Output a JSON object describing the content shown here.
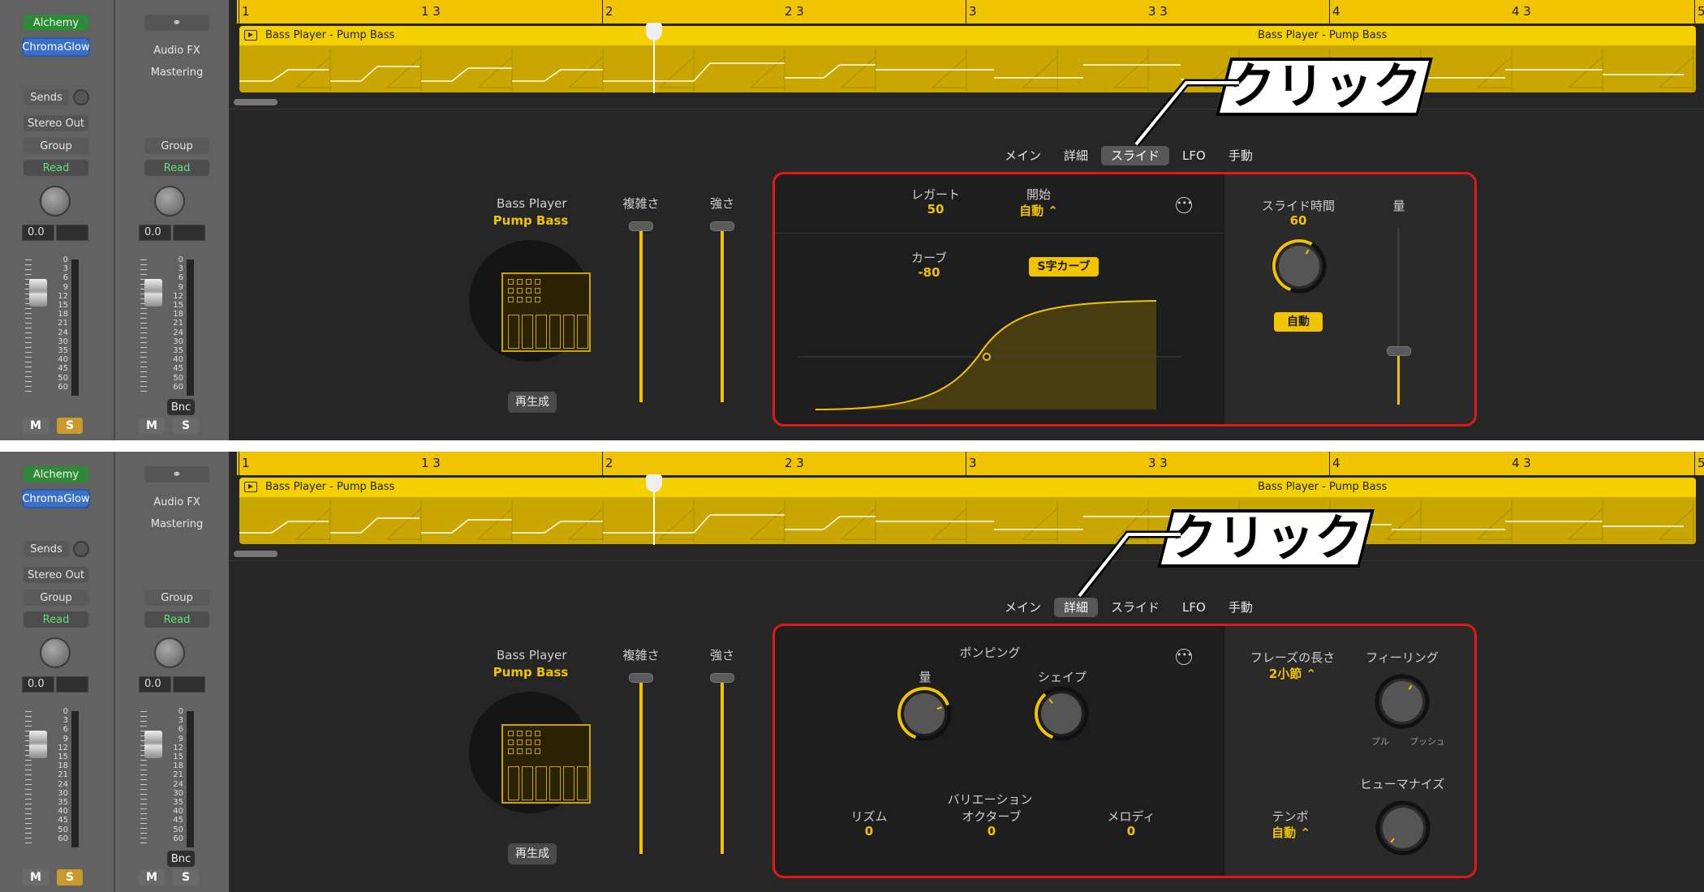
{
  "panels": [
    {
      "mixer": {
        "left": {
          "plugin1": "Alchemy",
          "plugin2": "ChromaGlow",
          "sends": "Sends",
          "output": "Stereo Out",
          "group": "Group",
          "automation": "Read",
          "volume": "0.0",
          "mute": "M",
          "solo": "S"
        },
        "right": {
          "slot_icon": "link-icon",
          "audio_fx": "Audio FX",
          "mastering": "Mastering",
          "group": "Group",
          "automation": "Read",
          "volume": "0.0",
          "bounce": "Bnc",
          "mute": "M",
          "solo": "S"
        },
        "scale": [
          "0",
          "3",
          "6",
          "9",
          "12",
          "15",
          "18",
          "21",
          "24",
          "30",
          "35",
          "40",
          "45",
          "50",
          "60"
        ]
      },
      "ruler": {
        "bars": [
          "1",
          "2",
          "3",
          "4",
          "5"
        ],
        "beats": [
          "1 3",
          "2 3",
          "3 3",
          "4 3"
        ]
      },
      "region": {
        "name": "Bass Player - Pump Bass",
        "name2": "Bass Player - Pump Bass"
      },
      "tabs": [
        "メイン",
        "詳細",
        "スライド",
        "LFO",
        "手動"
      ],
      "active_tab": 2,
      "player": {
        "title": "Bass Player",
        "preset": "Pump Bass",
        "complexity": "複雑さ",
        "intensity": "強さ",
        "regenerate": "再生成"
      },
      "slide": {
        "legato_label": "レガート",
        "legato_value": "50",
        "start_label": "開始",
        "start_value": "自動 ⌃",
        "curve_label": "カーブ",
        "curve_value": "-80",
        "s_curve": "S字カーブ",
        "slide_time_label": "スライド時間",
        "slide_time_value": "60",
        "auto": "自動",
        "amount_label": "量"
      },
      "callout": "クリック"
    },
    {
      "mixer": {
        "left": {
          "plugin1": "Alchemy",
          "plugin2": "ChromaGlow",
          "sends": "Sends",
          "output": "Stereo Out",
          "group": "Group",
          "automation": "Read",
          "volume": "0.0",
          "mute": "M",
          "solo": "S"
        },
        "right": {
          "slot_icon": "link-icon",
          "audio_fx": "Audio FX",
          "mastering": "Mastering",
          "group": "Group",
          "automation": "Read",
          "volume": "0.0",
          "bounce": "Bnc",
          "mute": "M",
          "solo": "S"
        },
        "scale": [
          "0",
          "3",
          "6",
          "9",
          "12",
          "15",
          "18",
          "21",
          "24",
          "30",
          "35",
          "40",
          "45",
          "50",
          "60"
        ]
      },
      "ruler": {
        "bars": [
          "1",
          "2",
          "3",
          "4",
          "5"
        ],
        "beats": [
          "1 3",
          "2 3",
          "3 3",
          "4 3"
        ]
      },
      "region": {
        "name": "Bass Player - Pump Bass",
        "name2": "Bass Player - Pump Bass"
      },
      "tabs": [
        "メイン",
        "詳細",
        "スライド",
        "LFO",
        "手動"
      ],
      "active_tab": 1,
      "player": {
        "title": "Bass Player",
        "preset": "Pump Bass",
        "complexity": "複雑さ",
        "intensity": "強さ",
        "regenerate": "再生成"
      },
      "detail": {
        "pumping": "ポンピング",
        "amount": "量",
        "shape": "シェイプ",
        "variation": "バリエーション",
        "rhythm_label": "リズム",
        "rhythm_value": "0",
        "octave_label": "オクターブ",
        "octave_value": "0",
        "melody_label": "メロディ",
        "melody_value": "0",
        "phrase_label": "フレーズの長さ",
        "phrase_value": "2小節 ⌃",
        "feel_label": "フィーリング",
        "pull": "プル",
        "push": "プッシュ",
        "tempo_label": "テンポ",
        "tempo_value": "自動 ⌃",
        "humanize_label": "ヒューマナイズ"
      },
      "callout": "クリック"
    }
  ]
}
